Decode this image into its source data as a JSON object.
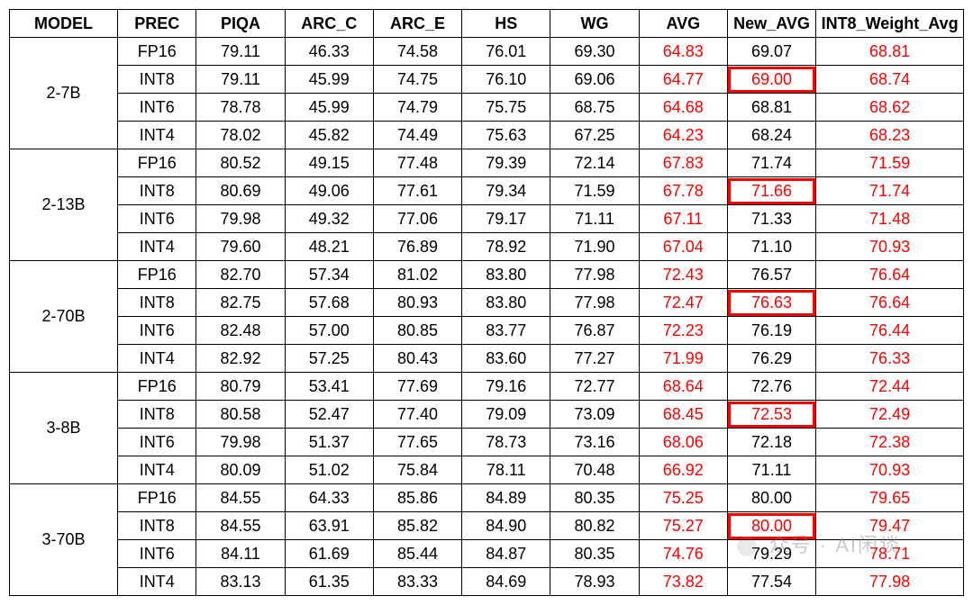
{
  "headers": {
    "model": "MODEL",
    "prec": "PREC",
    "piqa": "PIQA",
    "arc_c": "ARC_C",
    "arc_e": "ARC_E",
    "hs": "HS",
    "wg": "WG",
    "avg": "AVG",
    "new_avg": "New_AVG",
    "wavg": "INT8_Weight_Avg"
  },
  "watermark": "众号 · AI闲谈",
  "groups": [
    {
      "model": "2-7B",
      "rows": [
        {
          "prec": "FP16",
          "piqa": "79.11",
          "arc_c": "46.33",
          "arc_e": "74.58",
          "hs": "76.01",
          "wg": "69.30",
          "avg": "64.83",
          "new_avg": "69.07",
          "new_avg_hl": false,
          "wavg": "68.81"
        },
        {
          "prec": "INT8",
          "piqa": "79.11",
          "arc_c": "45.99",
          "arc_e": "74.75",
          "hs": "76.10",
          "wg": "69.06",
          "avg": "64.77",
          "new_avg": "69.00",
          "new_avg_hl": true,
          "wavg": "68.74"
        },
        {
          "prec": "INT6",
          "piqa": "78.78",
          "arc_c": "45.99",
          "arc_e": "74.79",
          "hs": "75.75",
          "wg": "68.75",
          "avg": "64.68",
          "new_avg": "68.81",
          "new_avg_hl": false,
          "wavg": "68.62"
        },
        {
          "prec": "INT4",
          "piqa": "78.02",
          "arc_c": "45.82",
          "arc_e": "74.49",
          "hs": "75.63",
          "wg": "67.25",
          "avg": "64.23",
          "new_avg": "68.24",
          "new_avg_hl": false,
          "wavg": "68.23"
        }
      ]
    },
    {
      "model": "2-13B",
      "rows": [
        {
          "prec": "FP16",
          "piqa": "80.52",
          "arc_c": "49.15",
          "arc_e": "77.48",
          "hs": "79.39",
          "wg": "72.14",
          "avg": "67.83",
          "new_avg": "71.74",
          "new_avg_hl": false,
          "wavg": "71.59"
        },
        {
          "prec": "INT8",
          "piqa": "80.69",
          "arc_c": "49.06",
          "arc_e": "77.61",
          "hs": "79.34",
          "wg": "71.59",
          "avg": "67.78",
          "new_avg": "71.66",
          "new_avg_hl": true,
          "wavg": "71.74"
        },
        {
          "prec": "INT6",
          "piqa": "79.98",
          "arc_c": "49.32",
          "arc_e": "77.06",
          "hs": "79.17",
          "wg": "71.11",
          "avg": "67.11",
          "new_avg": "71.33",
          "new_avg_hl": false,
          "wavg": "71.48"
        },
        {
          "prec": "INT4",
          "piqa": "79.60",
          "arc_c": "48.21",
          "arc_e": "76.89",
          "hs": "78.92",
          "wg": "71.90",
          "avg": "67.04",
          "new_avg": "71.10",
          "new_avg_hl": false,
          "wavg": "70.93"
        }
      ]
    },
    {
      "model": "2-70B",
      "rows": [
        {
          "prec": "FP16",
          "piqa": "82.70",
          "arc_c": "57.34",
          "arc_e": "81.02",
          "hs": "83.80",
          "wg": "77.98",
          "avg": "72.43",
          "new_avg": "76.57",
          "new_avg_hl": false,
          "wavg": "76.64"
        },
        {
          "prec": "INT8",
          "piqa": "82.75",
          "arc_c": "57.68",
          "arc_e": "80.93",
          "hs": "83.80",
          "wg": "77.98",
          "avg": "72.47",
          "new_avg": "76.63",
          "new_avg_hl": true,
          "wavg": "76.64"
        },
        {
          "prec": "INT6",
          "piqa": "82.48",
          "arc_c": "57.00",
          "arc_e": "80.85",
          "hs": "83.77",
          "wg": "76.87",
          "avg": "72.23",
          "new_avg": "76.19",
          "new_avg_hl": false,
          "wavg": "76.44"
        },
        {
          "prec": "INT4",
          "piqa": "82.92",
          "arc_c": "57.25",
          "arc_e": "80.43",
          "hs": "83.60",
          "wg": "77.27",
          "avg": "71.99",
          "new_avg": "76.29",
          "new_avg_hl": false,
          "wavg": "76.33"
        }
      ]
    },
    {
      "model": "3-8B",
      "rows": [
        {
          "prec": "FP16",
          "piqa": "80.79",
          "arc_c": "53.41",
          "arc_e": "77.69",
          "hs": "79.16",
          "wg": "72.77",
          "avg": "68.64",
          "new_avg": "72.76",
          "new_avg_hl": false,
          "wavg": "72.44"
        },
        {
          "prec": "INT8",
          "piqa": "80.58",
          "arc_c": "52.47",
          "arc_e": "77.40",
          "hs": "79.09",
          "wg": "73.09",
          "avg": "68.45",
          "new_avg": "72.53",
          "new_avg_hl": true,
          "wavg": "72.49"
        },
        {
          "prec": "INT6",
          "piqa": "79.98",
          "arc_c": "51.37",
          "arc_e": "77.65",
          "hs": "78.73",
          "wg": "73.16",
          "avg": "68.06",
          "new_avg": "72.18",
          "new_avg_hl": false,
          "wavg": "72.38"
        },
        {
          "prec": "INT4",
          "piqa": "80.09",
          "arc_c": "51.02",
          "arc_e": "75.84",
          "hs": "78.11",
          "wg": "70.48",
          "avg": "66.92",
          "new_avg": "71.11",
          "new_avg_hl": false,
          "wavg": "70.93"
        }
      ]
    },
    {
      "model": "3-70B",
      "rows": [
        {
          "prec": "FP16",
          "piqa": "84.55",
          "arc_c": "64.33",
          "arc_e": "85.86",
          "hs": "84.89",
          "wg": "80.35",
          "avg": "75.25",
          "new_avg": "80.00",
          "new_avg_hl": false,
          "wavg": "79.65"
        },
        {
          "prec": "INT8",
          "piqa": "84.55",
          "arc_c": "63.91",
          "arc_e": "85.82",
          "hs": "84.90",
          "wg": "80.82",
          "avg": "75.27",
          "new_avg": "80.00",
          "new_avg_hl": true,
          "wavg": "79.47"
        },
        {
          "prec": "INT6",
          "piqa": "84.11",
          "arc_c": "61.69",
          "arc_e": "85.44",
          "hs": "84.87",
          "wg": "80.35",
          "avg": "74.76",
          "new_avg": "79.29",
          "new_avg_hl": false,
          "wavg": "78.71"
        },
        {
          "prec": "INT4",
          "piqa": "83.13",
          "arc_c": "61.35",
          "arc_e": "83.33",
          "hs": "84.69",
          "wg": "78.93",
          "avg": "73.82",
          "new_avg": "77.54",
          "new_avg_hl": false,
          "wavg": "77.98"
        }
      ]
    }
  ]
}
